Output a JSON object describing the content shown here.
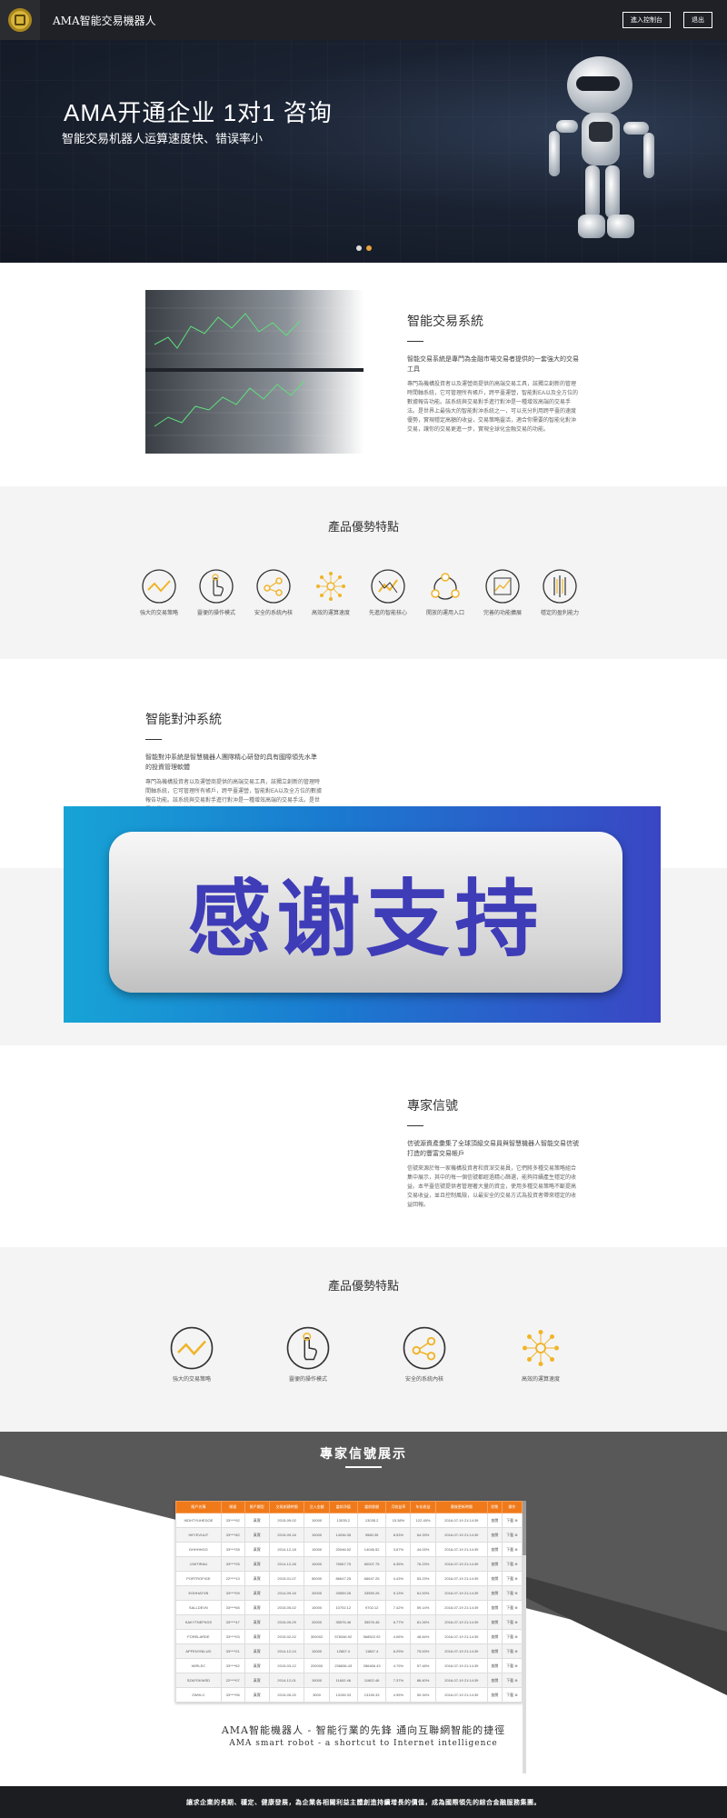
{
  "header": {
    "brand": "AMA智能交易機器人",
    "buttons": [
      "進入控制台",
      "退出"
    ]
  },
  "hero": {
    "title": "AMA开通企业 1对1 咨询",
    "subtitle": "智能交易机器人运算速度快、错误率小",
    "carousel": {
      "count": 2,
      "active": 1
    }
  },
  "trading_system": {
    "title": "智能交易系統",
    "lead": "智能交易系統是專門為金融市場交易者提供的一套強大的交易工具",
    "body": "專門為機構投資者以及運營商提供的高端交易工具，該獨立創新的管理時間軸系統，它可管理所有帳戶，跨平臺運營，智能對EA以及全方位的數據報告功能。該系統與交易對手進行對沖是一種增效高端的交易手法。是世界上最強大的智能對沖系統之一，可以充分利用跨平臺的速度優勢，實現穩定高額的收益，交易策略靈活，適合你需要的智能化對沖交易，讓你的交易更進一步，實現全球化金融交易的功能。"
  },
  "features1": {
    "title": "產品優勢特點",
    "items": [
      "強大的交易策略",
      "靈便的操作模式",
      "安全的系統內核",
      "高效的運算速度",
      "先進的智能核心",
      "開放的運用入口",
      "完善的功能擴展",
      "穩定的盈利能力"
    ]
  },
  "hedge_system": {
    "title": "智能對沖系統",
    "lead": "智能對沖系統是智慧機器人團隊精心研發的具有國際領先水準的投資管理軟體",
    "body": "專門為機構投資者以及運營商提供的高端交易工具，該獨立創新的管理時間軸系統，它可管理所有帳戶，跨平臺運營，智能對EA以及全方位的數據報告功能。該系統與交易對手進行對沖是一種增效高端的交易手法。是世界上最強大的智能對沖系統之一。"
  },
  "overlay_banner": {
    "text": "感谢支持"
  },
  "expert_signal": {
    "title": "專家信號",
    "lead": "信號源資產彙集了全球頂級交易員與智慧機器人智能交易信號打造的豐富交易帳戶",
    "body": "信號來源於每一家機構投資者和資深交易員，它們將多種交易策略組合集中展示，其中的每一個信號都經過精心篩選，能夠持續產生穩定的收益。本平臺信號提供者管理著大量的資金，使用多種交易策略不斷提高交易收益，並且控制風險，以最安全的交易方式為投資者帶來穩定的收益回報。"
  },
  "features2": {
    "title": "產品優勢特點",
    "items": [
      "強大的交易策略",
      "靈便的操作模式",
      "安全的系統內核",
      "高效的運算速度"
    ]
  },
  "showcase": {
    "title": "專家信號展示",
    "columns": [
      "賬戶名稱",
      "賬號",
      "賬戶類型",
      "交易創建時間",
      "注入金額",
      "當前淨值",
      "當前餘額",
      "月收益率",
      "年化收益",
      "最後更新時間",
      "狀態",
      "操作"
    ],
    "rows": [
      [
        "IKDHTYUHEDOE",
        "33****92",
        "真實",
        "2015-09-02",
        "10000",
        "13035.2",
        "13035.2",
        "15.38%",
        "122.45%",
        "2016-07-19 21:14:39",
        "查閱",
        "下載 ⊕"
      ],
      [
        "HEYEVUUT",
        "33****82",
        "真實",
        "2015-09-16",
        "10000",
        "14036.35",
        "9580.35",
        "8.53%",
        "64.33%",
        "2016-07-19 21:14:39",
        "查閱",
        "下載 ⊕"
      ],
      [
        "DHHHHGG",
        "33****28",
        "真實",
        "2014-12-18",
        "10000",
        "20046.52",
        "14046.52",
        "3.67%",
        "44.03%",
        "2016-07-19 21:14:39",
        "查閱",
        "下載 ⊕"
      ],
      [
        "JJWTIRAU",
        "33****25",
        "真實",
        "2014-12-26",
        "10000",
        "75067.75",
        "60007.75",
        "6.35%",
        "76.23%",
        "2016-07-19 21:14:39",
        "查閱",
        "下載 ⊕"
      ],
      [
        "PORTROFIGE",
        "22****13",
        "真實",
        "2015-01-07",
        "50000",
        "86647.25",
        "66647.25",
        "4.43%",
        "53.23%",
        "2016-07-19 21:14:39",
        "查閱",
        "下載 ⊕"
      ],
      [
        "EGHHATVB",
        "33****09",
        "真實",
        "2014-09-16",
        "20000",
        "33559.26",
        "33559.26",
        "5.13%",
        "61.53%",
        "2016-07-19 21:14:39",
        "查閱",
        "下載 ⊕"
      ],
      [
        "SALLDEVN",
        "33****65",
        "真實",
        "2015-05-02",
        "10000",
        "10702.12",
        "9702.12",
        "7.42%",
        "59.14%",
        "2016-07-19 21:14:39",
        "查閱",
        "下載 ⊕"
      ],
      [
        "KAKYTNEFKDS",
        "33****47",
        "真實",
        "2015-09-29",
        "20000",
        "35576.46",
        "35576.46",
        "6.77%",
        "81.26%",
        "2016-07-19 21:14:39",
        "查閱",
        "下載 ⊕"
      ],
      [
        "FORELARDE",
        "33****03",
        "真實",
        "2015-02-02",
        "300002",
        "578346.92",
        "568522.92",
        "4.06%",
        "48.84%",
        "2016-07-19 21:14:39",
        "查閱",
        "下載 ⊕"
      ],
      [
        "APFENYNILUD",
        "33****21",
        "真實",
        "2014-12-24",
        "10000",
        "12867.4",
        "11867.4",
        "6.29%",
        "75.53%",
        "2016-07-19 21:14:39",
        "查閱",
        "下載 ⊕"
      ],
      [
        "WIRLEC",
        "33****62",
        "真實",
        "2015-03-12",
        "200000",
        "236656.43",
        "286466.43",
        "4.79%",
        "57.48%",
        "2016-07-19 21:14:39",
        "查閱",
        "下載 ⊕"
      ],
      [
        "SZAFGKWSD",
        "22****07",
        "真實",
        "2014-12-01",
        "10000",
        "11602.46",
        "11602.46",
        "7.37%",
        "88.40%",
        "2016-07-19 21:14:39",
        "查閱",
        "下載 ⊕"
      ],
      [
        "ZWHLC",
        "33****06",
        "真實",
        "2015-05-20",
        "3000",
        "13155.33",
        "13155.33",
        "4.95%",
        "59.34%",
        "2016-07-19 21:14:39",
        "查閱",
        "下載 ⊕"
      ]
    ],
    "slogan_cn": "AMA智能機器人 - 智能行業的先鋒 通向互聯網智能的捷徑",
    "slogan_en": "AMA smart robot - a shortcut to Internet intelligence"
  },
  "footer": {
    "text": "讓求企業的長期、穩定、健康發展，為企業各相關利益主體創造持續增長的價值，成為國際領先的綜合金融服務集團。"
  },
  "colors": {
    "header_bg": "#1f2126",
    "accent_orange": "#f07a1a",
    "icon_gold": "#f0b429",
    "footer_bg": "#1c1d20",
    "showcase_dark": "#585858"
  }
}
